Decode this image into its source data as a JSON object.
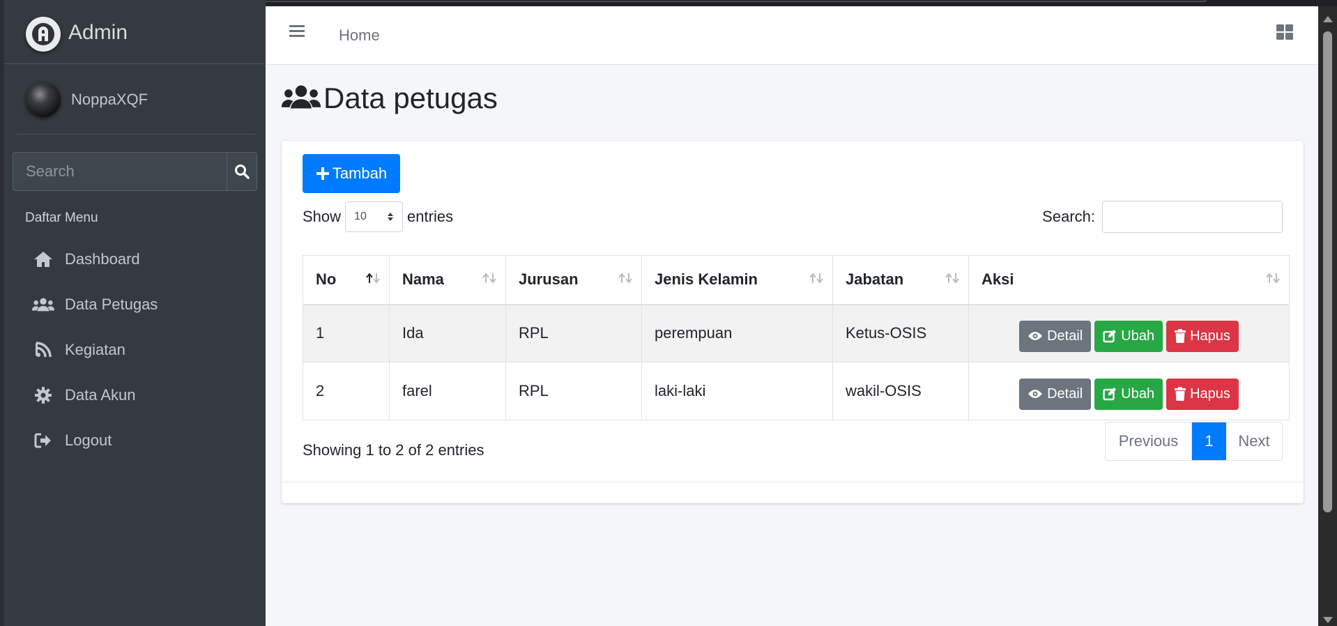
{
  "brand": {
    "title": "Admin"
  },
  "user": {
    "name": "NoppaXQF"
  },
  "sidebar": {
    "search_placeholder": "Search",
    "menu_header": "Daftar Menu",
    "items": [
      {
        "label": "Dashboard",
        "icon": "home-icon"
      },
      {
        "label": "Data Petugas",
        "icon": "users-icon"
      },
      {
        "label": "Kegiatan",
        "icon": "rss-icon"
      },
      {
        "label": "Data Akun",
        "icon": "gear-icon"
      },
      {
        "label": "Logout",
        "icon": "logout-icon"
      }
    ]
  },
  "navbar": {
    "home": "Home"
  },
  "page": {
    "title": "Data petugas"
  },
  "toolbar": {
    "add_label": "Tambah",
    "show_label": "Show",
    "entries_label": "entries",
    "entries_value": "10",
    "search_label": "Search:"
  },
  "table": {
    "columns": [
      "No",
      "Nama",
      "Jurusan",
      "Jenis Kelamin",
      "Jabatan",
      "Aksi"
    ],
    "rows": [
      {
        "no": "1",
        "nama": "Ida",
        "jurusan": "RPL",
        "jenis_kelamin": "perempuan",
        "jabatan": "Ketus-OSIS"
      },
      {
        "no": "2",
        "nama": "farel",
        "jurusan": "RPL",
        "jenis_kelamin": "laki-laki",
        "jabatan": "wakil-OSIS"
      }
    ],
    "actions": {
      "detail": "Detail",
      "ubah": "Ubah",
      "hapus": "Hapus"
    }
  },
  "footer": {
    "info": "Showing 1 to 2 of 2 entries",
    "previous": "Previous",
    "page": "1",
    "next": "Next"
  },
  "colors": {
    "sidebar_bg": "#343a40",
    "primary": "#007bff",
    "success": "#28a745",
    "danger": "#dc3545",
    "secondary": "#6c757d"
  }
}
